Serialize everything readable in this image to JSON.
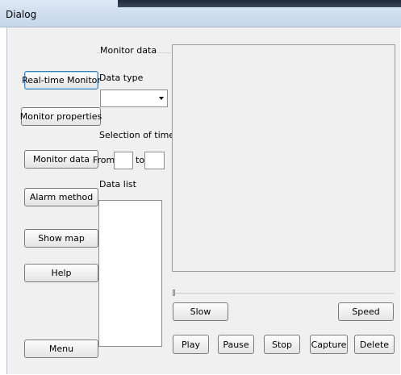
{
  "window": {
    "title": "Dialog"
  },
  "nav": {
    "realtime_monitor": "Real-time Monitor",
    "monitor_properties": "Monitor properties",
    "monitor_data": "Monitor data",
    "alarm_method": "Alarm method",
    "show_map": "Show map",
    "help": "Help",
    "menu": "Menu"
  },
  "panel": {
    "group_title": "Monitor data",
    "data_type_label": "Data type",
    "data_type_value": "",
    "selection_label": "Selection of time",
    "from_label": "From",
    "from_value": "",
    "to_label": "to",
    "to_value": "",
    "data_list_label": "Data list"
  },
  "playback": {
    "slow": "Slow",
    "speed": "Speed",
    "play": "Play",
    "pause": "Pause",
    "stop": "Stop",
    "capture": "Capture",
    "delete": "Delete"
  }
}
